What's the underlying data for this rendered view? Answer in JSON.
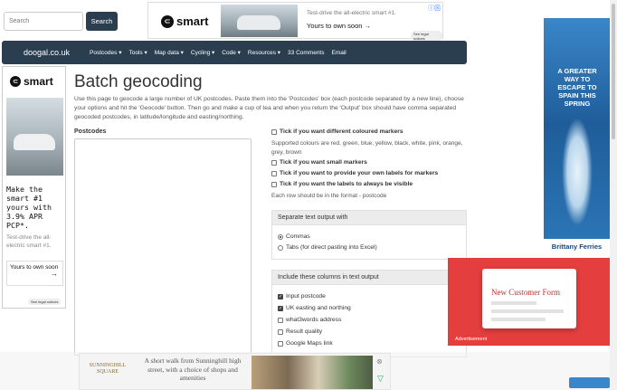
{
  "search": {
    "placeholder": "Search",
    "button_label": "Search"
  },
  "top_ad": {
    "brand": "smart",
    "text": "Test-drive the all-electric smart #1.",
    "cta": "Yours to own soon →",
    "legal": "See legal notices"
  },
  "navbar": {
    "brand": "doogal.co.uk",
    "items": [
      "Postcodes ▾",
      "Tools ▾",
      "Map data ▾",
      "Cycling ▾",
      "Code ▾",
      "Resources ▾",
      "33 Comments",
      "Email"
    ]
  },
  "left_ad": {
    "brand": "smart",
    "headline": "Make the smart #1 yours with 3.9% APR PCP*.",
    "text": "Test-drive the all-electric smart #1.",
    "cta": "Yours to own soon",
    "legal": "See legal notices"
  },
  "main": {
    "title": "Batch geocoding",
    "intro": "Use this page to geocode a large number of UK postcodes. Paste them into the 'Postcodes' box (each postcode separated by a new line), choose your options and hit the 'Geocode' button. Then go and make a cup of tea and when you return the 'Output' box should have comma separated geocoded postcodes, in latitude/longitude and easting/northing.",
    "postcodes_label": "Postcodes"
  },
  "options": {
    "coloured_markers": "Tick if you want different coloured markers",
    "colours_help": "Supported colours are red, green, blue, yellow, black, white, pink, orange, grey, brown",
    "small_markers": "Tick if you want small markers",
    "own_labels": "Tick if you want to provide your own labels for markers",
    "labels_visible": "Tick if you want the labels to always be visible",
    "row_format": "Each row should be in the format - postcode"
  },
  "separator_panel": {
    "heading": "Separate text output with",
    "commas": "Commas",
    "tabs": "Tabs (for direct pasting into Excel)"
  },
  "columns_panel": {
    "heading": "Include these columns in text output",
    "items": [
      {
        "label": "Input postcode",
        "checked": true
      },
      {
        "label": "UK easting and northing",
        "checked": true
      },
      {
        "label": "what3words address",
        "checked": false
      },
      {
        "label": "Result quality",
        "checked": false
      },
      {
        "label": "Google Maps link",
        "checked": false
      }
    ]
  },
  "right_ad": {
    "headline": "A GREATER WAY TO ESCAPE TO SPAIN THIS SPRING",
    "brand": "Brittany Ferries"
  },
  "video_ad": {
    "title": "New Customer Form",
    "label": "Advertisement"
  },
  "bottom_ad": {
    "brand": "SUNNINGHILL SQUARE",
    "text": "A short walk from Sunninghill high street, with a choice of shops and amenities"
  },
  "colors": {
    "navbar": "#2b3e50",
    "right_ad": "#2a72b8",
    "video_ad": "#e53e3e"
  }
}
